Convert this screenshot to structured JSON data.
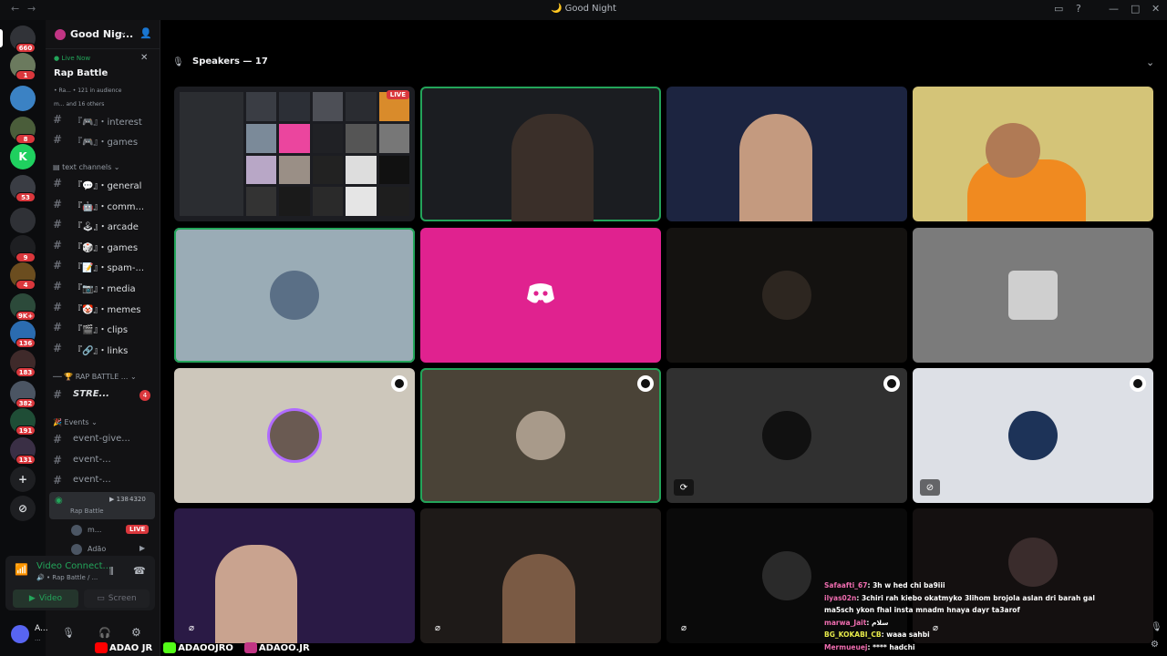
{
  "titlebar": {
    "back": "←",
    "forward": "→",
    "title": "Good Night"
  },
  "rail": {
    "servers": [
      {
        "label": "",
        "badge": "660",
        "color": "#313338"
      },
      {
        "label": "",
        "badge": "1",
        "color": "#6b7a5e"
      },
      {
        "label": "",
        "badge": "",
        "color": "#3b82c4"
      },
      {
        "label": "",
        "badge": "8",
        "color": "#4a5d3a"
      },
      {
        "label": "K",
        "badge": "",
        "color": "#1fd05f"
      },
      {
        "label": "",
        "badge": "53",
        "color": "#3a3d44"
      },
      {
        "label": "",
        "badge": "",
        "color": "#2f3136"
      },
      {
        "label": "",
        "badge": "9",
        "color": "#1e1f22"
      },
      {
        "label": "",
        "badge": "4",
        "color": "#6b4d1f"
      },
      {
        "label": "",
        "badge": "9K+",
        "color": "#2c4a3a"
      },
      {
        "label": "",
        "badge": "136",
        "color": "#2b6cb0"
      },
      {
        "label": "",
        "badge": "183",
        "color": "#3f2a2a"
      },
      {
        "label": "",
        "badge": "382",
        "color": "#4b5563"
      },
      {
        "label": "",
        "badge": "191",
        "color": "#1f4d36"
      },
      {
        "label": "",
        "badge": "131",
        "color": "#3a2f45"
      }
    ],
    "add": "+",
    "discover": "⊘"
  },
  "sidebar": {
    "guild_name": "Good Nig...",
    "live_now": "Live Now",
    "stage_title": "Rap Battle",
    "stage_sub1": "• Ra... • 121 in audience",
    "stage_sub2": "m... and 16 others",
    "channels": [
      {
        "name": "『🎮』・interest",
        "light": false
      },
      {
        "name": "『🎮』・games",
        "light": false
      }
    ],
    "text_category": "text channels ⌄",
    "text_channels": [
      {
        "name": "『💬』・general"
      },
      {
        "name": "『🤖』・comm..."
      },
      {
        "name": "『🕹』・arcade"
      },
      {
        "name": "『🎲』・games"
      },
      {
        "name": "『📝』・spam-..."
      },
      {
        "name": "『📷』・media"
      },
      {
        "name": "『🤡』・memes"
      },
      {
        "name": "『🎬』・clips"
      },
      {
        "name": "『🔗』・links"
      }
    ],
    "rap_category": "RAP BATTLE ...",
    "stream_channel": "STRE...",
    "stream_badge": "4",
    "events_category": "Events ⌄",
    "event_channels": [
      {
        "name": "event-give..."
      },
      {
        "name": "event-..."
      },
      {
        "name": "event-..."
      }
    ],
    "voice": {
      "count": "138",
      "audience": "4320",
      "label": "Rap Battle"
    },
    "voice_users": [
      {
        "name": "m...",
        "live": "LIVE"
      },
      {
        "name": "Adão",
        "live": ""
      }
    ],
    "connection": {
      "status": "Video Connect...",
      "sub": "🔊 • Rap Battle / ...",
      "video": "Video",
      "screen": "Screen"
    },
    "user": {
      "name": "A...",
      "sub": "..."
    }
  },
  "stage": {
    "header": "Speakers — 17",
    "live": "LIVE"
  },
  "chat": [
    {
      "user": "Safaafti_67",
      "msg": ": 3h w hed chi ba9iii"
    },
    {
      "user": "ilyas02n",
      "msg": ": 3chiri rah kiebo okatmyko 3lihom brojola aslan dri barah gal ma5sch ykon fhal insta mnadm hnaya dayr ta3arof"
    },
    {
      "user": "marwa_Jait",
      "msg": ": سلام"
    },
    {
      "user": "BG_KOKABI_CB",
      "msg": ": waaa sahbi"
    },
    {
      "user": "Mermueuej",
      "msg": ": **** hadchi"
    }
  ],
  "watermark": [
    "ADAO JR",
    "ADAOOJRO",
    "ADAOO.JR"
  ],
  "colors": {
    "accent_green": "#23a55a",
    "discord_pink": "#eb459e",
    "live_red": "#da373c"
  }
}
